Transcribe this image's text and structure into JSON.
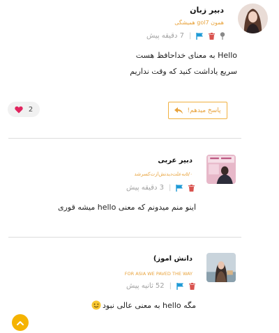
{
  "posts": [
    {
      "author": "دبیر زبان",
      "subtitle": "همون gol7 همیشگی",
      "time": "7 دقیقه پیش",
      "lines": [
        "Hello به معنای خداحافظ هست",
        "سریع یاداشت کنید که وقت نداریم"
      ]
    },
    {
      "author": "دبیر عربی",
      "subtitle": "۵/۰به‌علت‌دیدنش‌ازت‌کسرشد",
      "time": "3 دقیقه پیش",
      "lines": [
        "اینو منم میدونم که معنی hello میشه قوری"
      ]
    },
    {
      "author": "دانش اموز)",
      "subtitle": "FOR ASIA WE PAVED THE WAY",
      "time": "52 ثانیه پیش",
      "lines": [
        "مگه hello به معنی عالی نبود"
      ]
    }
  ],
  "actions": {
    "reply_label": "پاسخ میدهم!",
    "like_count": "2"
  },
  "separator": "|",
  "icons": {
    "delete": "trash-icon",
    "flag": "flag-icon",
    "pin": "pin-icon",
    "reply": "reply-arrow-icon",
    "like": "heart-icon",
    "scroll": "chevron-up-icon",
    "emoji": "emoji-icon"
  },
  "colors": {
    "accent": "#e8a23a",
    "flag": "#1e9ad6",
    "delete": "#d9534f",
    "heart": "#e0245e",
    "scroll_button": "#f5b301",
    "muted": "#a0a0a0"
  }
}
